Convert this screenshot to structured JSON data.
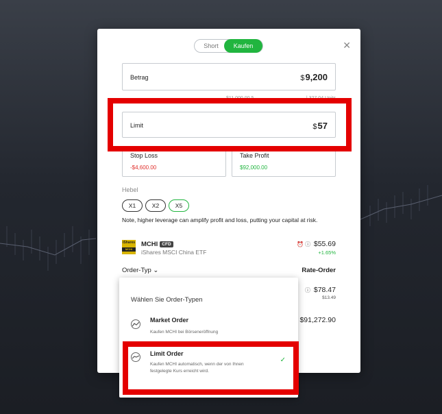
{
  "toggle": {
    "short_label": "Short",
    "buy_label": "Kaufen"
  },
  "amount": {
    "label": "Betrag",
    "currency": "$",
    "value": "9,200"
  },
  "amount_sub": {
    "left": "$11,000.00 5...",
    "right": "| 327.04 Units"
  },
  "limit": {
    "label": "Limit",
    "currency": "$",
    "value": "57"
  },
  "stop_loss": {
    "label": "Stop Loss",
    "value": "-$4,600.00"
  },
  "take_profit": {
    "label": "Take Profit",
    "value": "$92,000.00"
  },
  "leverage": {
    "label": "Hebel",
    "options": [
      "X1",
      "X2",
      "X5"
    ],
    "selected": "X5"
  },
  "note": "Note, higher leverage can amplify profit and loss, putting your capital at risk.",
  "asset": {
    "logo_text": "iShares",
    "logo_sub": "MCHI",
    "symbol": "MCHI",
    "badge": "CFD",
    "name": "iShares MSCI China ETF",
    "price": "$55.69",
    "change": "+1.65%"
  },
  "order": {
    "type_label": "Order-Typ",
    "type_value": "Rate-Order",
    "hidden_price": "$78.47",
    "hidden_small": "$13.49",
    "hidden_total": "$91,272.90"
  },
  "dropdown": {
    "title": "Wählen Sie Order-Typen",
    "options": [
      {
        "title": "Market Order",
        "desc": "Kaufen MCHI bei Börseneröffnung"
      },
      {
        "title": "Limit Order",
        "desc": "Kaufen MCHI automatisch, wenn der von Ihnen festgelegte Kurs erreicht wird."
      }
    ]
  },
  "colors": {
    "accent": "#21b53f",
    "negative": "#e0302d",
    "highlight": "#e40000"
  }
}
